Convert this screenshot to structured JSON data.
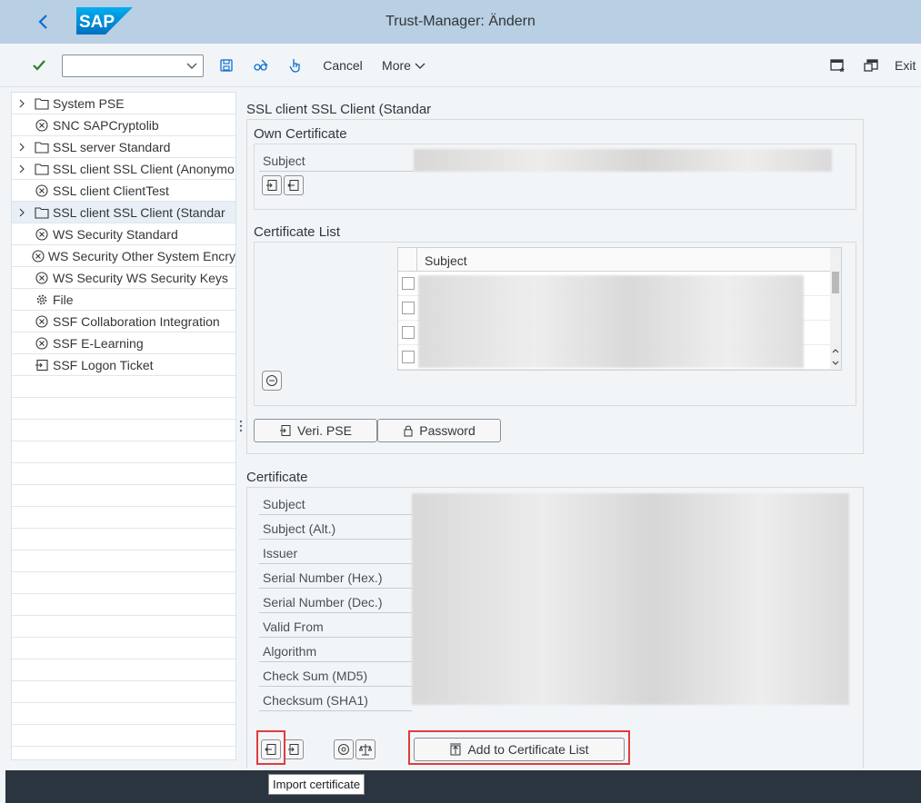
{
  "header": {
    "app_title": "Trust-Manager: Ändern",
    "logo_text": "SAP"
  },
  "toolbar": {
    "cancel_label": "Cancel",
    "more_label": "More",
    "exit_label": "Exit",
    "okcode_value": ""
  },
  "tree": {
    "items": [
      {
        "label": "System PSE",
        "icon": "folder-icon",
        "expandable": true
      },
      {
        "label": "SNC SAPCryptolib",
        "icon": "circle-x-icon",
        "expandable": false
      },
      {
        "label": "SSL server Standard",
        "icon": "folder-icon",
        "expandable": true
      },
      {
        "label": "SSL client SSL Client (Anonymo",
        "icon": "folder-icon",
        "expandable": true
      },
      {
        "label": "SSL client ClientTest",
        "icon": "circle-x-icon",
        "expandable": false
      },
      {
        "label": "SSL client SSL Client (Standar",
        "icon": "folder-icon",
        "expandable": true,
        "selected": true
      },
      {
        "label": "WS Security Standard",
        "icon": "circle-x-icon",
        "expandable": false
      },
      {
        "label": "WS Security Other System Encry",
        "icon": "circle-x-icon",
        "expandable": false
      },
      {
        "label": "WS Security WS Security Keys",
        "icon": "circle-x-icon",
        "expandable": false
      },
      {
        "label": "File",
        "icon": "gear-icon",
        "expandable": false
      },
      {
        "label": "SSF Collaboration Integration",
        "icon": "circle-x-icon",
        "expandable": false
      },
      {
        "label": "SSF E-Learning",
        "icon": "circle-x-icon",
        "expandable": false
      },
      {
        "label": "SSF Logon Ticket",
        "icon": "ticket-icon",
        "expandable": false
      }
    ]
  },
  "pse": {
    "title": "SSL client SSL Client (Standar",
    "own_certificate": {
      "title": "Own Certificate",
      "subject_label": "Subject"
    },
    "certificate_list": {
      "title": "Certificate List",
      "column_subject": "Subject"
    },
    "veri_pse_label": "Veri. PSE",
    "password_label": "Password"
  },
  "certificate": {
    "title": "Certificate",
    "fields": [
      "Subject",
      "Subject (Alt.)",
      "Issuer",
      "Serial Number (Hex.)",
      "Serial Number (Dec.)",
      "Valid From",
      "Algorithm",
      "Check Sum (MD5)",
      "Checksum (SHA1)"
    ],
    "add_to_list_label": "Add to Certificate List"
  },
  "tooltip": {
    "text": "Import certificate"
  },
  "colors": {
    "header_bg": "#b9cfe3",
    "highlight": "#e03c3c",
    "check_green": "#2b7d2b"
  }
}
